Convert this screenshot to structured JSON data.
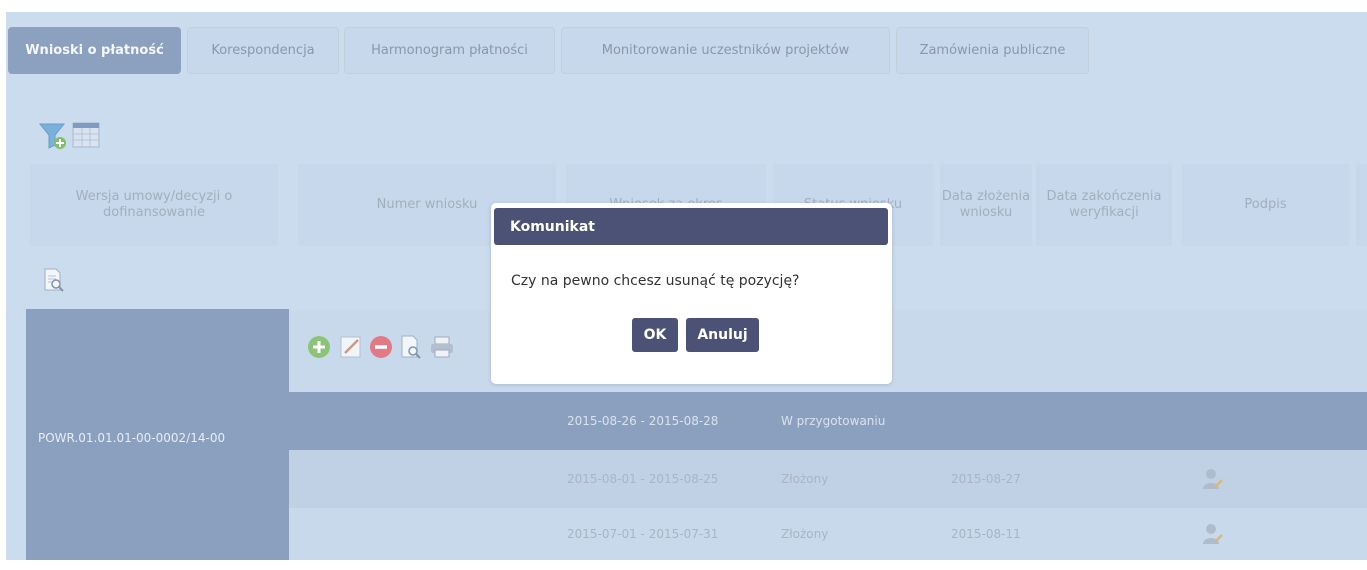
{
  "tabs": [
    {
      "label": "Wnioski o płatność",
      "active": true
    },
    {
      "label": "Korespondencja",
      "active": false
    },
    {
      "label": "Harmonogram płatności",
      "active": false
    },
    {
      "label": "Monitorowanie uczestników projektów",
      "active": false
    },
    {
      "label": "Zamówienia publiczne",
      "active": false
    }
  ],
  "toolbar_icons": [
    "filter-add-icon",
    "table-icon"
  ],
  "table": {
    "headers": [
      "Wersja umowy/decyzji o dofinansowanie",
      "Numer wniosku",
      "Wniosek za okres",
      "Status wniosku",
      "Data złożenia wniosku",
      "Data zakończenia weryfikacji",
      "Podpis"
    ],
    "preview_icon": "document-preview-icon",
    "group_label": "POWR.01.01.01-00-0002/14-00",
    "row_toolbar_icons": [
      "add-icon",
      "edit-icon",
      "delete-icon",
      "preview-icon",
      "print-icon"
    ],
    "rows": [
      {
        "period": "2015-08-26 - 2015-08-28",
        "status": "W przygotowaniu",
        "submitted": "",
        "signed": false
      },
      {
        "period": "2015-08-01 - 2015-08-25",
        "status": "Złożony",
        "submitted": "2015-08-27",
        "signed": true
      },
      {
        "period": "2015-07-01 - 2015-07-31",
        "status": "Złożony",
        "submitted": "2015-08-11",
        "signed": true
      }
    ]
  },
  "dialog": {
    "title": "Komunikat",
    "message": "Czy na pewno chcesz usunąć tę pozycję?",
    "ok_label": "OK",
    "cancel_label": "Anuluj"
  },
  "colors": {
    "dialog_header": "#4b5275",
    "active_tab": "#8ca0bf",
    "background": "#cbdcef"
  }
}
